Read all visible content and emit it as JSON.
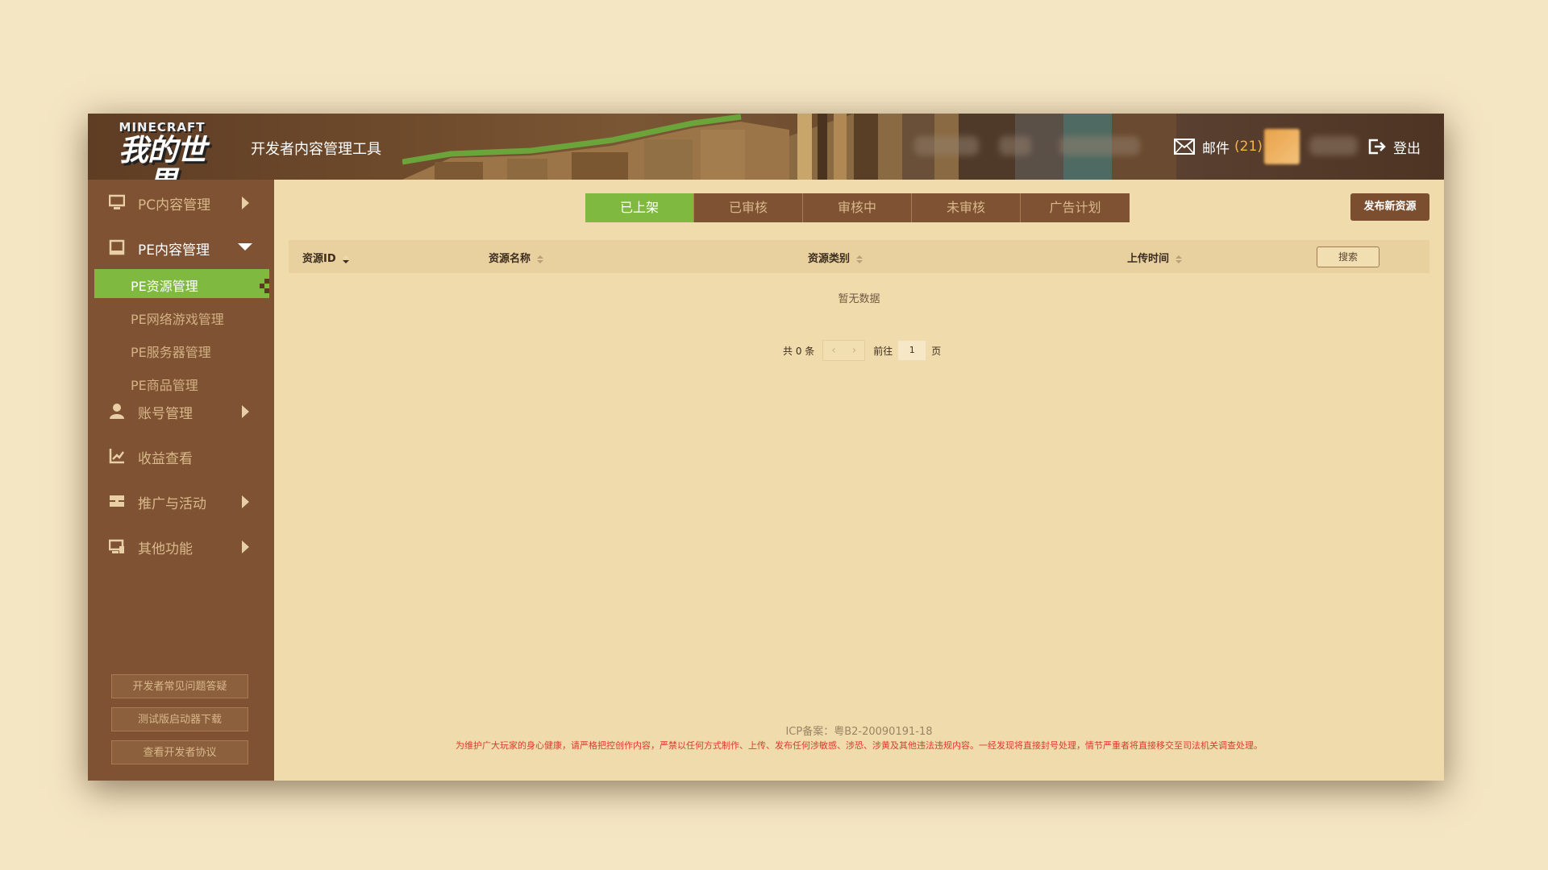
{
  "header": {
    "logo_en": "MINECRAFT",
    "logo_cn": "我的世界",
    "app_title": "开发者内容管理工具",
    "mail_label": "邮件",
    "mail_count": "(21)",
    "logout_label": "登出"
  },
  "sidebar": {
    "pc": "PC内容管理",
    "pe": "PE内容管理",
    "pe_sub": [
      "PE资源管理",
      "PE网络游戏管理",
      "PE服务器管理",
      "PE商品管理"
    ],
    "account": "账号管理",
    "revenue": "收益查看",
    "promo": "推广与活动",
    "other": "其他功能",
    "buttons": [
      "开发者常见问题答疑",
      "测试版启动器下载",
      "查看开发者协议"
    ]
  },
  "tabs": [
    "已上架",
    "已审核",
    "审核中",
    "未审核",
    "广告计划"
  ],
  "publish_label": "发布新资源",
  "table": {
    "columns": [
      "资源ID",
      "资源名称",
      "资源类别",
      "上传时间"
    ],
    "search_label": "搜索",
    "empty_text": "暂无数据"
  },
  "pager": {
    "total": "共 0 条",
    "prev": "‹",
    "next": "›",
    "goto": "前往",
    "page": "1",
    "page_unit": "页"
  },
  "footer": {
    "icp": "ICP备案：粤B2-20090191-18",
    "warning": "为维护广大玩家的身心健康，请严格把控创作内容，严禁以任何方式制作、上传、发布任何涉敏感、涉恐、涉黄及其他违法违规内容。一经发现将直接封号处理，情节严重者将直接移交至司法机关调查处理。"
  },
  "colors": {
    "accent_green": "#7fb93f",
    "sidebar_brown": "#7e5233",
    "content_bg": "#efdbab",
    "page_bg": "#f4e5c3",
    "mail_count": "#f5b63a",
    "warning_red": "#e03a2e"
  }
}
